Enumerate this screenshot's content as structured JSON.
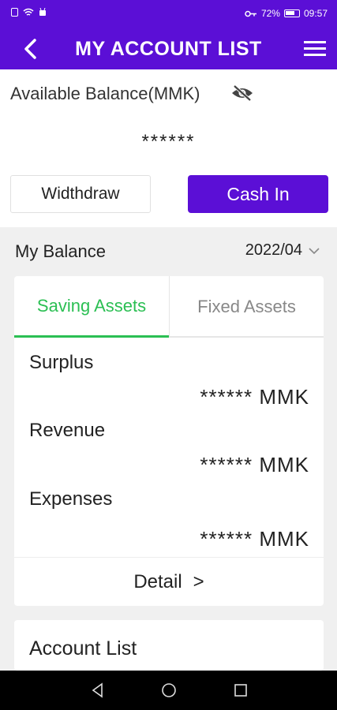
{
  "status_bar": {
    "battery": "72%",
    "time": "09:57"
  },
  "appbar": {
    "title": "MY ACCOUNT LIST",
    "back_icon": "chevron-left-icon",
    "menu_icon": "hamburger-menu-icon"
  },
  "balance": {
    "label": "Available Balance(MMK)",
    "value": "******",
    "visibility_icon": "eye-off-icon"
  },
  "actions": {
    "withdraw_label": "Widthdraw",
    "cashin_label": "Cash In"
  },
  "my_balance": {
    "label": "My Balance",
    "period": "2022/04"
  },
  "tabs": [
    {
      "label": "Saving Assets",
      "active": true
    },
    {
      "label": "Fixed Assets",
      "active": false
    }
  ],
  "rows": [
    {
      "label": "Surplus",
      "value": "****** MMK"
    },
    {
      "label": "Revenue",
      "value": "****** MMK"
    },
    {
      "label": "Expenses",
      "value": "****** MMK"
    }
  ],
  "detail": {
    "label": "Detail",
    "arrow": ">"
  },
  "account_list": {
    "label": "Account List"
  },
  "colors": {
    "brand": "#5b0fd6",
    "active_tab": "#2bbf53"
  }
}
